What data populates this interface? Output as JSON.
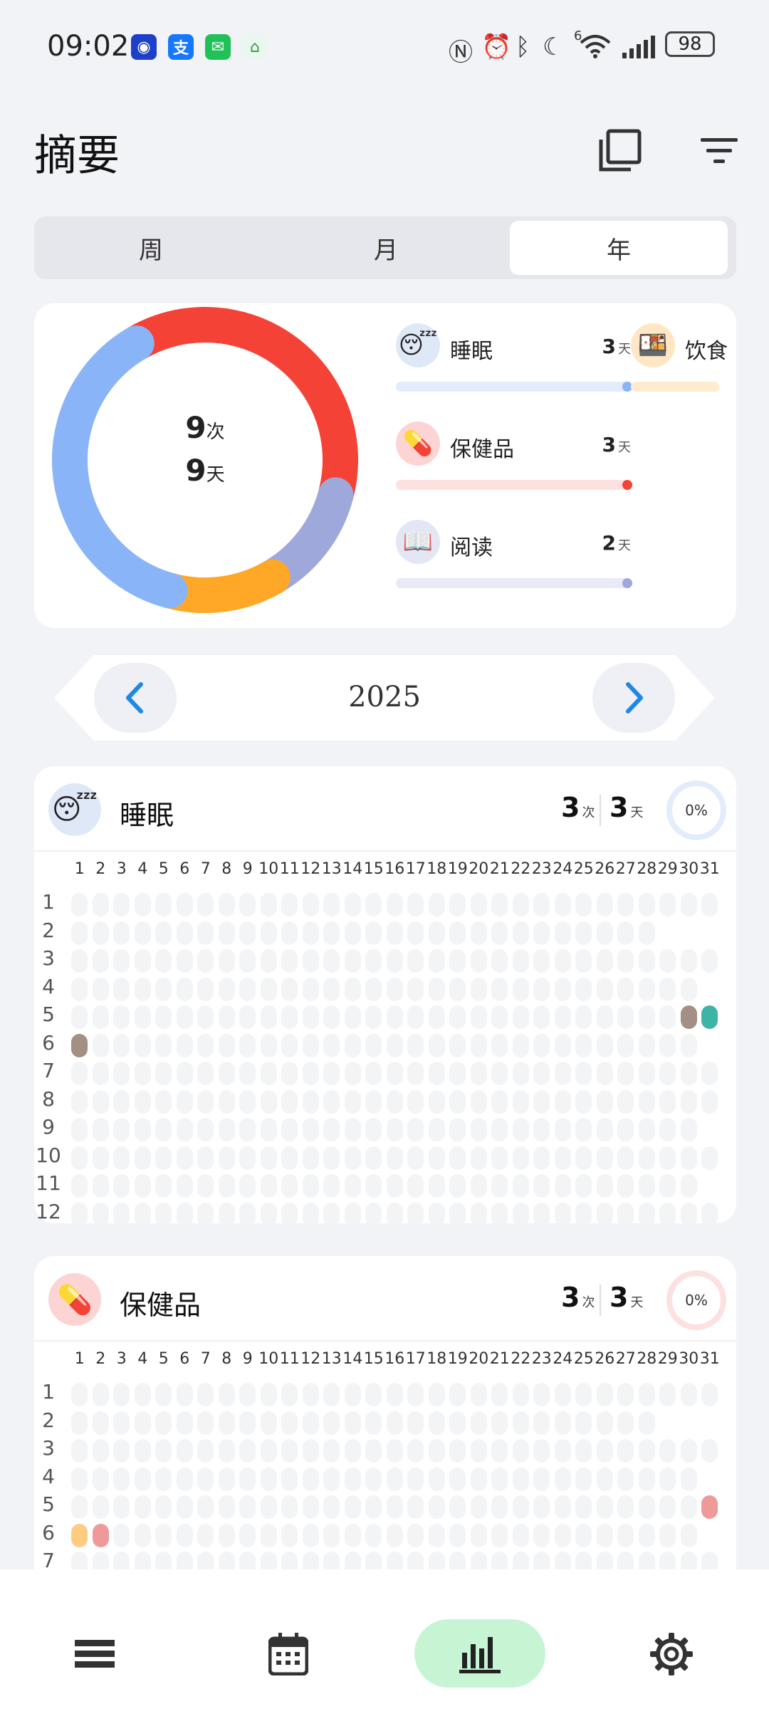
{
  "status_bar": {
    "time": "09:02",
    "battery": "98",
    "signal_label": "6"
  },
  "header": {
    "title": "摘要"
  },
  "tabs": [
    {
      "label": "周"
    },
    {
      "label": "月"
    },
    {
      "label": "年",
      "active": true
    }
  ],
  "summary": {
    "count_value": "9",
    "count_unit": "次",
    "days_value": "9",
    "days_unit": "天",
    "donut": [
      {
        "value": 3,
        "color": "#f44336"
      },
      {
        "value": 1,
        "color": "#9fa8da"
      },
      {
        "value": 1,
        "color": "#ffa726"
      },
      {
        "value": 3,
        "color": "#8ab4f8"
      }
    ],
    "legend": [
      {
        "label": "睡眠",
        "count": "3",
        "unit": "天",
        "emoji": "😴",
        "icon_bg": "#dfe8f7",
        "bar_color": "#e3ecfb",
        "dot_color": "#8ab4f8"
      },
      {
        "label": "保健品",
        "count": "3",
        "unit": "天",
        "emoji": "💊",
        "icon_bg": "#fcd4d4",
        "bar_color": "#fde0e0",
        "dot_color": "#f44336"
      },
      {
        "label": "阅读",
        "count": "2",
        "unit": "天",
        "emoji": "📖",
        "icon_bg": "#e3e6f3",
        "bar_color": "#e8eaf6",
        "dot_color": "#9fa8da"
      },
      {
        "label": "饮食",
        "emoji": "🍱",
        "icon_bg": "#ffe6c4",
        "bar_color": "#ffecce"
      }
    ]
  },
  "year_nav": {
    "year": "2025"
  },
  "sections": [
    {
      "title": "睡眠",
      "emoji": "😴",
      "icon_bg": "#dfe8f7",
      "count_value": "3",
      "count_unit": "次",
      "days_value": "3",
      "days_unit": "天",
      "percent": "0%",
      "ring_color": "#e3ecfb",
      "columns": [
        "1",
        "2",
        "3",
        "4",
        "5",
        "6",
        "7",
        "8",
        "9",
        "10",
        "11",
        "12",
        "13",
        "14",
        "15",
        "16",
        "17",
        "18",
        "19",
        "20",
        "21",
        "22",
        "23",
        "24",
        "25",
        "26",
        "27",
        "28",
        "29",
        "30",
        "31"
      ],
      "rows": [
        "1",
        "2",
        "3",
        "4",
        "5",
        "6",
        "7",
        "8",
        "9",
        "10",
        "11",
        "12"
      ],
      "marks": [
        {
          "month": 5,
          "day": 30,
          "color": "#a38f84"
        },
        {
          "month": 5,
          "day": 31,
          "color": "#3fb3a6"
        },
        {
          "month": 6,
          "day": 1,
          "color": "#a38f84"
        }
      ]
    },
    {
      "title": "保健品",
      "emoji": "💊",
      "icon_bg": "#fcd4d4",
      "count_value": "3",
      "count_unit": "次",
      "days_value": "3",
      "days_unit": "天",
      "percent": "0%",
      "ring_color": "#fde0e0",
      "columns": [
        "1",
        "2",
        "3",
        "4",
        "5",
        "6",
        "7",
        "8",
        "9",
        "10",
        "11",
        "12",
        "13",
        "14",
        "15",
        "16",
        "17",
        "18",
        "19",
        "20",
        "21",
        "22",
        "23",
        "24",
        "25",
        "26",
        "27",
        "28",
        "29",
        "30",
        "31"
      ],
      "rows": [
        "1",
        "2",
        "3",
        "4",
        "5",
        "6",
        "7"
      ],
      "marks": [
        {
          "month": 5,
          "day": 31,
          "color": "#ef9a9a"
        },
        {
          "month": 6,
          "day": 1,
          "color": "#ffcc80"
        },
        {
          "month": 6,
          "day": 2,
          "color": "#ef9a9a"
        }
      ]
    }
  ],
  "bottom_nav": [
    {
      "name": "list"
    },
    {
      "name": "calendar"
    },
    {
      "name": "stats",
      "active": true
    },
    {
      "name": "settings"
    }
  ]
}
